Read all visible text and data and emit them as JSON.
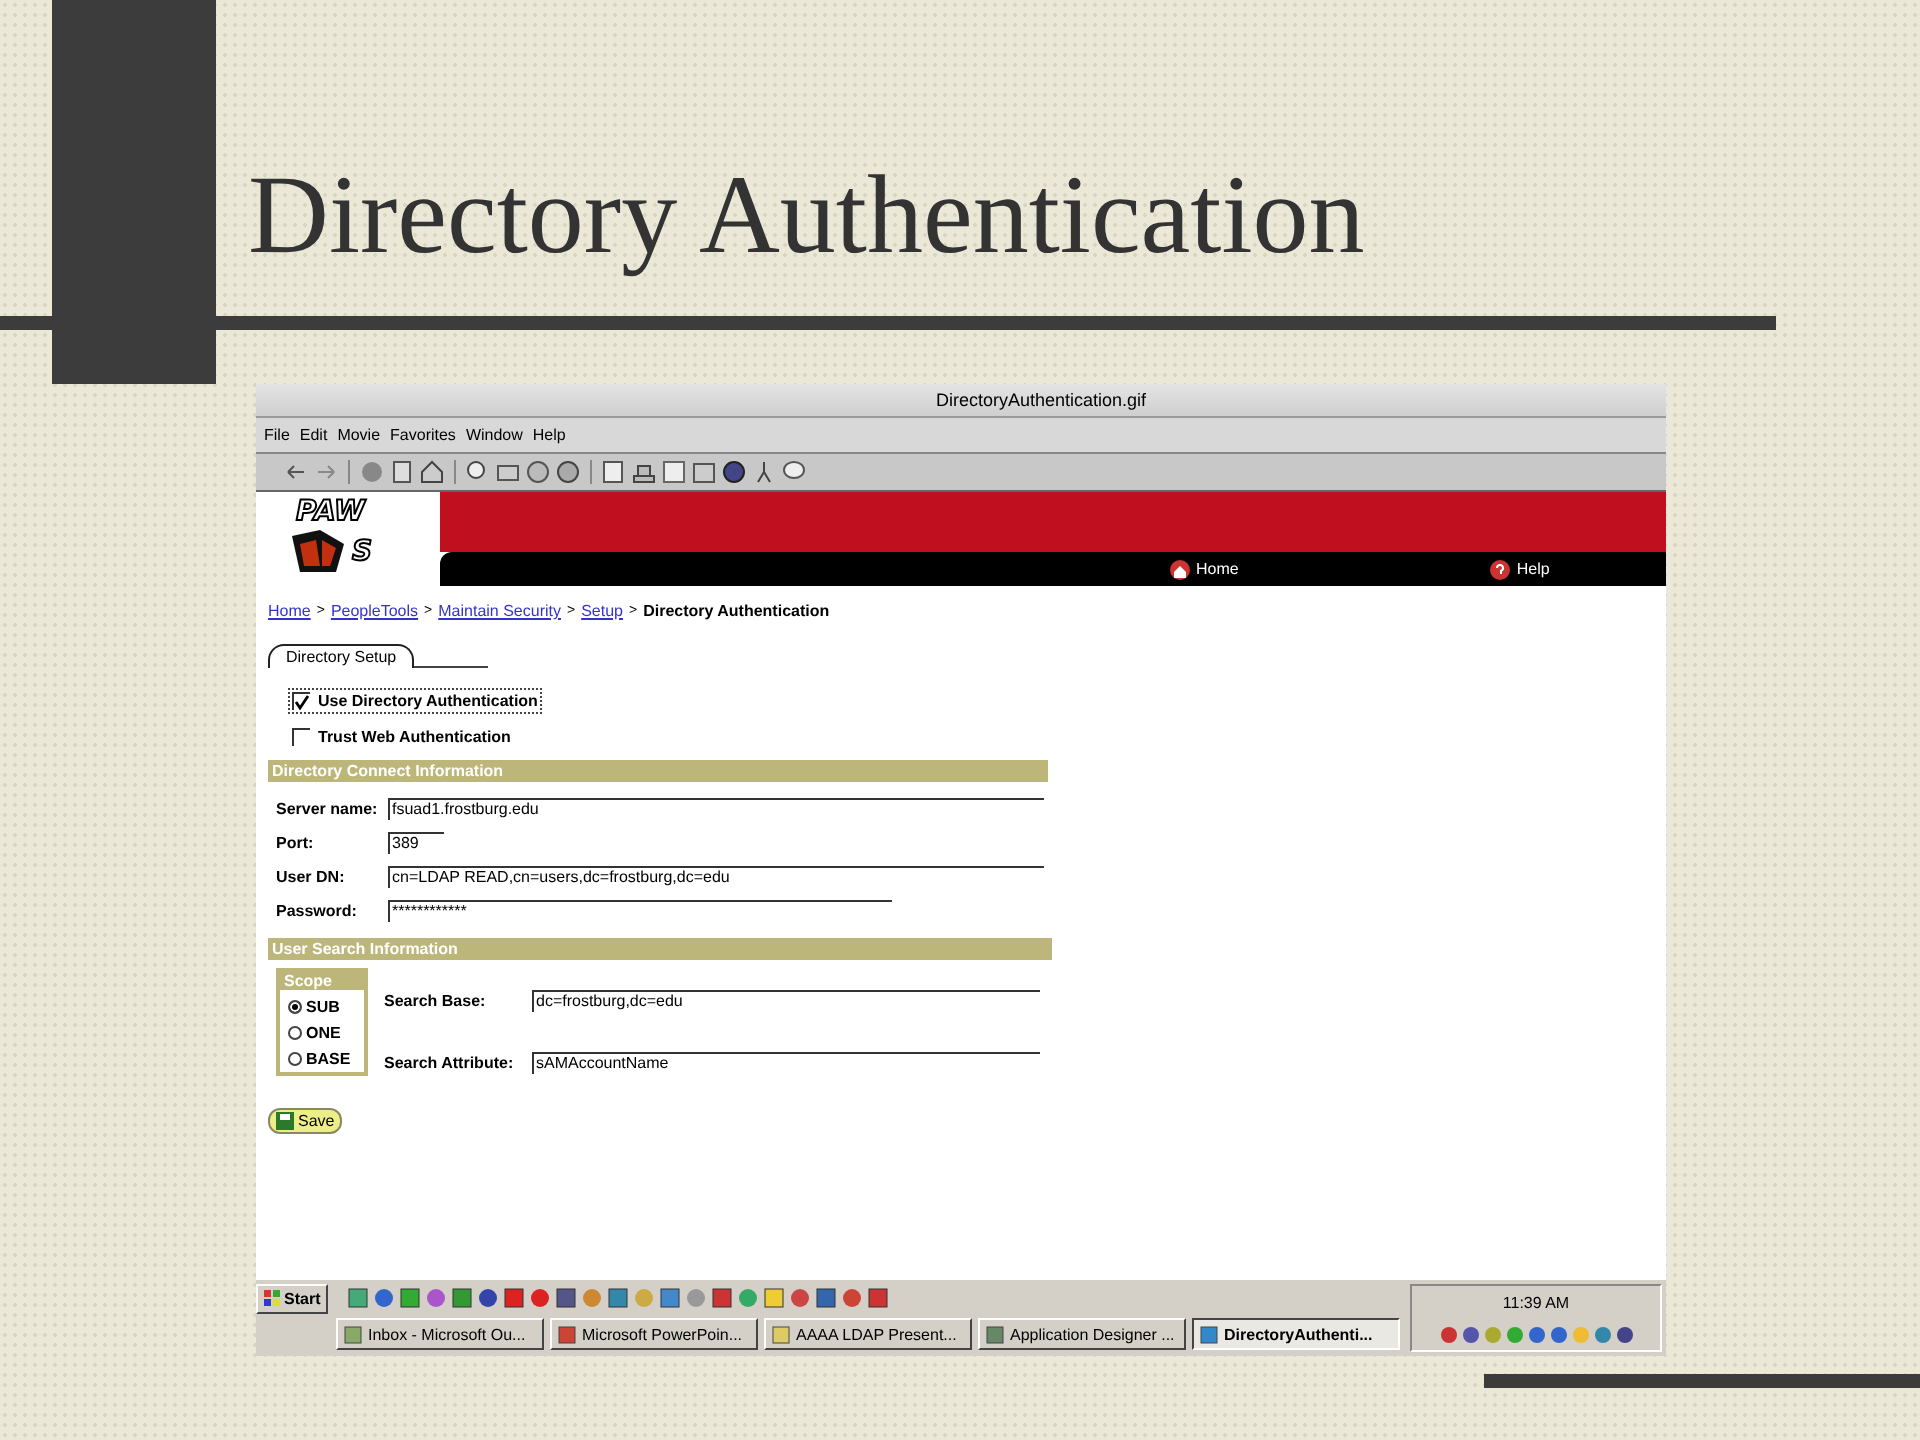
{
  "slide": {
    "title": "Directory Authentication"
  },
  "window": {
    "title": "DirectoryAuthentication.gif",
    "menu": [
      "File",
      "Edit",
      "Movie",
      "Favorites",
      "Window",
      "Help"
    ],
    "logo": {
      "top": "PAW",
      "bottom": "S"
    },
    "nav": [
      {
        "label": "Home",
        "kind": "home"
      },
      {
        "label": "Help",
        "kind": "help"
      }
    ],
    "breadcrumb": [
      {
        "label": "Home",
        "kind": "link"
      },
      {
        "label": ">",
        "kind": "separator"
      },
      {
        "label": "PeopleTools",
        "kind": "link"
      },
      {
        "label": ">",
        "kind": "separator"
      },
      {
        "label": "Maintain Security",
        "kind": "link"
      },
      {
        "label": ">",
        "kind": "separator"
      },
      {
        "label": "Setup",
        "kind": "link"
      },
      {
        "label": ">",
        "kind": "separator"
      },
      {
        "label": "Directory Authentication",
        "kind": "current"
      }
    ],
    "tabs": [
      {
        "label": "Directory Setup",
        "selected": true
      }
    ],
    "checkboxes": [
      {
        "label": "Use Directory Authentication",
        "checked": true,
        "focused": true
      },
      {
        "label": "Trust Web Authentication",
        "checked": false,
        "focused": false
      }
    ],
    "connect": {
      "title": "Directory Connect Information",
      "fields": [
        {
          "label": "Server name:",
          "value": "fsuad1.frostburg.edu",
          "kind": "long"
        },
        {
          "label": "Port:",
          "value": "389",
          "kind": "short"
        },
        {
          "label": "User DN:",
          "value": "cn=LDAP READ,cn=users,dc=frostburg,dc=edu",
          "kind": "long"
        },
        {
          "label": "Password:",
          "value": "************",
          "kind": "medium"
        }
      ]
    },
    "search": {
      "title": "User Search Information",
      "scope": {
        "title": "Scope",
        "options": [
          {
            "label": "SUB",
            "selected": true
          },
          {
            "label": "ONE",
            "selected": false
          },
          {
            "label": "BASE",
            "selected": false
          }
        ]
      },
      "fields": [
        {
          "label": "Search Base:",
          "value": "dc=frostburg,dc=edu"
        },
        {
          "label": "Search Attribute:",
          "value": "sAMAccountName"
        }
      ]
    },
    "save_button": "Save",
    "taskbar": {
      "start": "Start",
      "tasks": [
        {
          "label": "Inbox - Microsoft Ou...",
          "selected": false
        },
        {
          "label": "Microsoft PowerPoin...",
          "selected": false
        },
        {
          "label": "AAAA LDAP Present...",
          "selected": false
        },
        {
          "label": "Application Designer ...",
          "selected": false
        },
        {
          "label": "DirectoryAuthenti...",
          "selected": true
        }
      ],
      "clock": "11:39 AM"
    }
  }
}
